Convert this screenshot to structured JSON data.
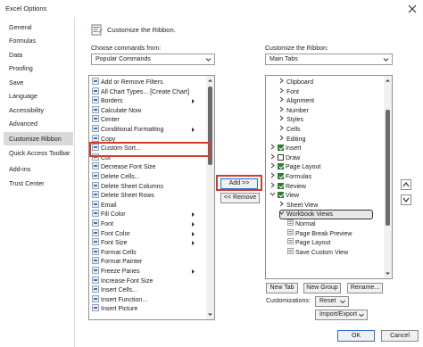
{
  "window": {
    "title": "Excel Options"
  },
  "nav": {
    "items": [
      {
        "label": "General"
      },
      {
        "label": "Formulas"
      },
      {
        "label": "Data"
      },
      {
        "label": "Proofing"
      },
      {
        "label": "Save"
      },
      {
        "label": "Language"
      },
      {
        "label": "Accessibility"
      },
      {
        "label": "Advanced"
      },
      {
        "label": "Customize Ribbon",
        "selected": true
      },
      {
        "label": "Quick Access Toolbar"
      },
      {
        "label": "Add-ins"
      },
      {
        "label": "Trust Center"
      }
    ]
  },
  "header": {
    "title": "Customize the Ribbon."
  },
  "left_panel": {
    "label": "Choose commands from:",
    "dropdown_value": "Popular Commands",
    "commands": [
      "Add or Remove Filters",
      "All Chart Types... [Create Chart]",
      "Borders",
      "Calculate Now",
      "Center",
      "Conditional Formatting",
      "Copy",
      "Custom Sort...",
      "Cut",
      "Decrease Font Size",
      "Delete Cells...",
      "Delete Sheet Columns",
      "Delete Sheet Rows",
      "Email",
      "Fill Color",
      "Font",
      "Font Color",
      "Font Size",
      "Format Cells",
      "Format Painter",
      "Freeze Panes",
      "Increase Font Size",
      "Insert Cells...",
      "Insert Function...",
      "Insert Picture"
    ]
  },
  "middle": {
    "add_label": "Add >>",
    "remove_label": "<< Remove"
  },
  "right_panel": {
    "label": "Customize the Ribbon:",
    "dropdown_value": "Main Tabs",
    "tree": [
      {
        "label": "Clipboard",
        "indent": 1,
        "caret": "right"
      },
      {
        "label": "Font",
        "indent": 1,
        "caret": "right"
      },
      {
        "label": "Alignment",
        "indent": 1,
        "caret": "right"
      },
      {
        "label": "Number",
        "indent": 1,
        "caret": "right"
      },
      {
        "label": "Styles",
        "indent": 1,
        "caret": "right"
      },
      {
        "label": "Cells",
        "indent": 1,
        "caret": "right"
      },
      {
        "label": "Editing",
        "indent": 1,
        "caret": "right"
      },
      {
        "label": "Insert",
        "indent": 0,
        "caret": "right",
        "checked": true
      },
      {
        "label": "Draw",
        "indent": 0,
        "caret": "right",
        "checked": false
      },
      {
        "label": "Page Layout",
        "indent": 0,
        "caret": "right",
        "checked": true
      },
      {
        "label": "Formulas",
        "indent": 0,
        "caret": "right",
        "checked": true
      },
      {
        "label": "Review",
        "indent": 0,
        "caret": "right",
        "checked": true
      },
      {
        "label": "View",
        "indent": 0,
        "caret": "down",
        "checked": true
      },
      {
        "label": "Sheet View",
        "indent": 1,
        "caret": "right"
      },
      {
        "label": "Workbook Views",
        "indent": 1,
        "caret": "down",
        "selected": true
      },
      {
        "label": "Normal",
        "indent": 2
      },
      {
        "label": "Page Break Preview",
        "indent": 2
      },
      {
        "label": "Page Layout",
        "indent": 2
      },
      {
        "label": "Save Custom View",
        "indent": 2
      }
    ],
    "new_tab_label": "New Tab",
    "new_group_label": "New Group",
    "rename_label": "Rename...",
    "customizations_label": "Customizations:",
    "reset_label": "Reset",
    "import_export_label": "Import/Export"
  },
  "footer": {
    "ok_label": "OK",
    "cancel_label": "Cancel"
  },
  "colors": {
    "highlight_red": "#d33a2c",
    "check_green": "#2e7d32",
    "nav_selected": "#d9d9d9"
  }
}
